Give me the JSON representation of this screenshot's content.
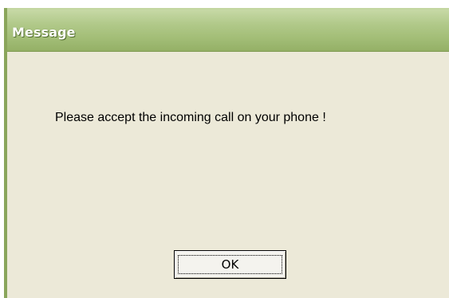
{
  "window": {
    "title": "Message"
  },
  "dialog": {
    "message": "Please accept the incoming call on your phone !",
    "ok_label": "OK"
  },
  "colors": {
    "titlebar": "#a2bd76",
    "window_background": "#ece9d8",
    "frame_border": "#8aa55b"
  }
}
